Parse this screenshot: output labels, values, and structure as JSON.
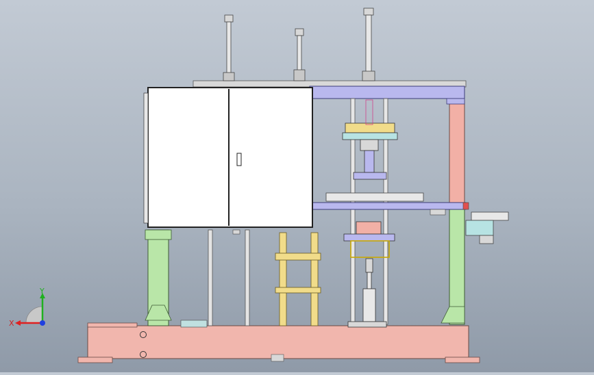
{
  "viewport": {
    "background_top": "#c2cad4",
    "background_bottom": "#8f9aa8"
  },
  "triad": {
    "x_label": "X",
    "y_label": "Y",
    "x_color": "#e02020",
    "y_color": "#20b020",
    "z_color": "#2040e0"
  },
  "model": {
    "cabinet_color": "#ffffff",
    "base_color": "#f1b6ad",
    "leg_green": "#b9e6a8",
    "post_yellow": "#f1dc8a",
    "frame_violet": "#b9b8ee",
    "frame_pink": "#f2b0a6",
    "rail_gray": "#d8d8d8"
  }
}
